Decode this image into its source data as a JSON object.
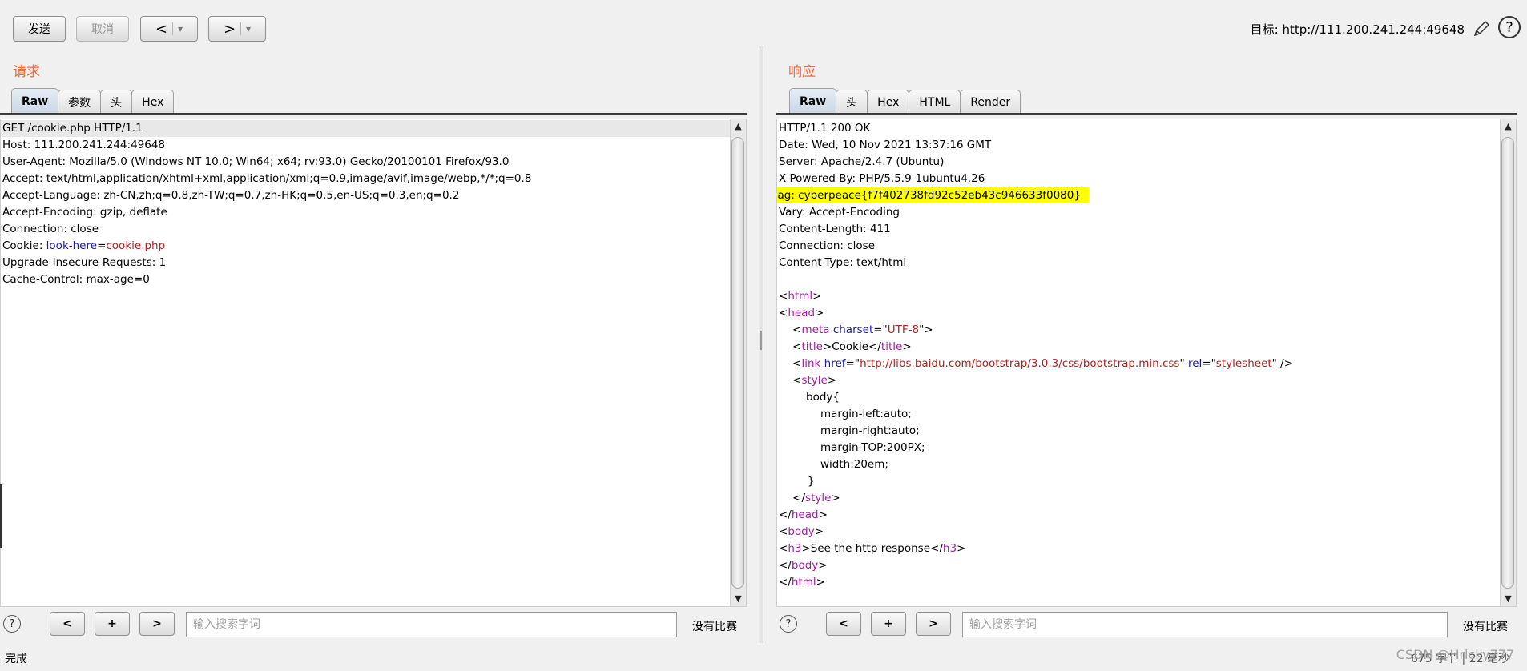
{
  "toolbar": {
    "send_label": "发送",
    "cancel_label": "取消",
    "back_label": "<",
    "forward_label": ">",
    "dropdown_glyph": "▾"
  },
  "target": {
    "label": "目标:",
    "url": "http://111.200.241.244:49648"
  },
  "icons": {
    "edit": "pencil-icon",
    "help": "?"
  },
  "request": {
    "title": "请求",
    "tabs": [
      "Raw",
      "参数",
      "头",
      "Hex"
    ],
    "active_tab": "Raw",
    "lines": [
      "GET /cookie.php HTTP/1.1",
      "Host: 111.200.241.244:49648",
      "User-Agent: Mozilla/5.0 (Windows NT 10.0; Win64; x64; rv:93.0) Gecko/20100101 Firefox/93.0",
      "Accept: text/html,application/xhtml+xml,application/xml;q=0.9,image/avif,image/webp,*/*;q=0.8",
      "Accept-Language: zh-CN,zh;q=0.8,zh-TW;q=0.7,zh-HK;q=0.5,en-US;q=0.3,en;q=0.2",
      "Accept-Encoding: gzip, deflate",
      "Connection: close"
    ],
    "cookie": {
      "prefix": "Cookie: ",
      "name": "look-here",
      "eq": "=",
      "value": "cookie.php"
    },
    "lines_after": [
      "Upgrade-Insecure-Requests: 1",
      "Cache-Control: max-age=0"
    ]
  },
  "response": {
    "title": "响应",
    "tabs": [
      "Raw",
      "头",
      "Hex",
      "HTML",
      "Render"
    ],
    "active_tab": "Raw",
    "headers_before": [
      "HTTP/1.1 200 OK",
      "Date: Wed, 10 Nov 2021 13:37:16 GMT",
      "Server: Apache/2.4.7 (Ubuntu)",
      "X-Powered-By: PHP/5.5.9-1ubuntu4.26"
    ],
    "flag_line": "flag: cyberpeace{f7f402738fd92c52eb43c946633f0080}",
    "headers_after": [
      "Vary: Accept-Encoding",
      "Content-Length: 411",
      "Connection: close",
      "Content-Type: text/html"
    ],
    "html": {
      "html_tag": "html",
      "head_tag": "head",
      "meta_tag": "meta",
      "meta_attr": "charset",
      "meta_val": "UTF-8",
      "title_tag": "title",
      "title_text": "Cookie",
      "link_tag": "link",
      "link_href_attr": "href",
      "link_href": "http://libs.baidu.com/bootstrap/3.0.3/css/bootstrap.min.css",
      "link_rel_attr": "rel",
      "link_rel": "stylesheet",
      "style_tag": "style",
      "css": [
        "body{",
        "margin-left:auto;",
        "margin-right:auto;",
        "margin-TOP:200PX;",
        "width:20em;",
        "}"
      ],
      "body_tag": "body",
      "h3_tag": "h3",
      "h3_text": "See the http response"
    }
  },
  "searchbar": {
    "placeholder": "输入搜索字词",
    "no_match": "没有比赛",
    "prev": "<",
    "add": "+",
    "next": ">"
  },
  "status": {
    "text": "完成",
    "info": "675 字节 | 22 毫秒"
  },
  "watermark": "CSDN @Hrlcky777"
}
